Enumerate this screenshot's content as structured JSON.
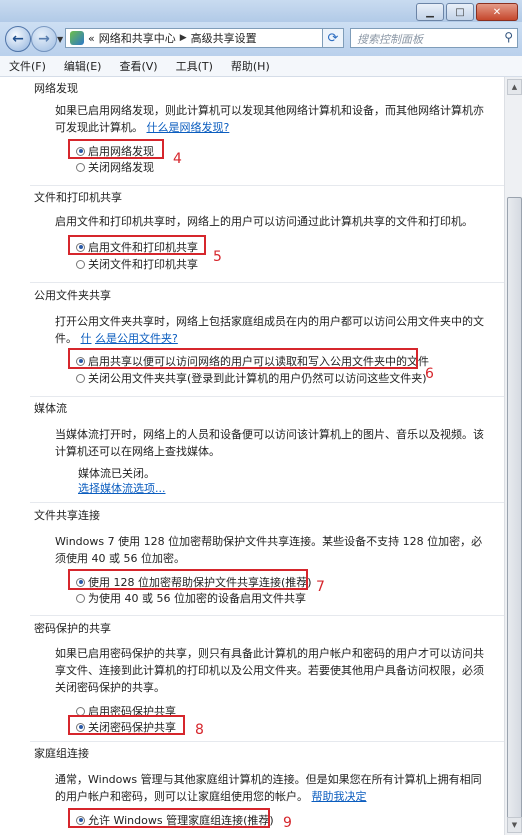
{
  "nav": {
    "breadcrumb": [
      "网络和共享中心",
      "高级共享设置"
    ],
    "crumb_prefix": "«",
    "search_placeholder": "搜索控制面板"
  },
  "menu": [
    "文件(F)",
    "编辑(E)",
    "查看(V)",
    "工具(T)",
    "帮助(H)"
  ],
  "sections": {
    "discovery": {
      "title": "网络发现",
      "desc": "如果已启用网络发现，则此计算机可以发现其他网络计算机和设备，而其他网络计算机亦可发现此计算机。",
      "link": "什么是网络发现?",
      "opt_on": "启用网络发现",
      "opt_off": "关闭网络发现",
      "marker": "4"
    },
    "printer": {
      "title": "文件和打印机共享",
      "desc": "启用文件和打印机共享时，网络上的用户可以访问通过此计算机共享的文件和打印机。",
      "opt_on": "启用文件和打印机共享",
      "opt_off": "关闭文件和打印机共享",
      "marker": "5"
    },
    "public": {
      "title": "公用文件夹共享",
      "desc": "打开公用文件夹共享时，网络上包括家庭组成员在内的用户都可以访问公用文件夹中的文件。",
      "link_a": "什",
      "link_b": "么是公用文件夹?",
      "opt_on": "启用共享以便可以访问网络的用户可以读取和写入公用文件夹中的文件",
      "opt_off": "关闭公用文件夹共享(登录到此计算机的用户仍然可以访问这些文件夹)",
      "marker": "6"
    },
    "media": {
      "title": "媒体流",
      "desc": "当媒体流打开时，网络上的人员和设备便可以访问该计算机上的图片、音乐以及视频。该计算机还可以在网络上查找媒体。",
      "status": "媒体流已关闭。",
      "link": "选择媒体流选项..."
    },
    "encryption": {
      "title": "文件共享连接",
      "desc": "Windows 7 使用 128 位加密帮助保护文件共享连接。某些设备不支持 128 位加密，必须使用 40 或 56 位加密。",
      "opt_on": "使用 128 位加密帮助保护文件共享连接(推荐)",
      "opt_off": "为使用 40 或 56 位加密的设备启用文件共享",
      "marker": "7"
    },
    "password": {
      "title": "密码保护的共享",
      "desc": "如果已启用密码保护的共享，则只有具备此计算机的用户帐户和密码的用户才可以访问共享文件、连接到此计算机的打印机以及公用文件夹。若要使其他用户具备访问权限，必须关闭密码保护的共享。",
      "opt_on": "启用密码保护共享",
      "opt_off": "关闭密码保护共享",
      "marker": "8"
    },
    "homegroup": {
      "title": "家庭组连接",
      "desc": "通常，Windows 管理与其他家庭组计算机的连接。但是如果您在所有计算机上拥有相同的用户帐户和密码，则可以让家庭组使用您的帐户。",
      "link": "帮助我决定",
      "opt_on": "允许 Windows 管理家庭组连接(推荐)",
      "marker": "9"
    }
  },
  "colors": {
    "accent_red": "#d6262c",
    "link": "#0b5dbf"
  }
}
